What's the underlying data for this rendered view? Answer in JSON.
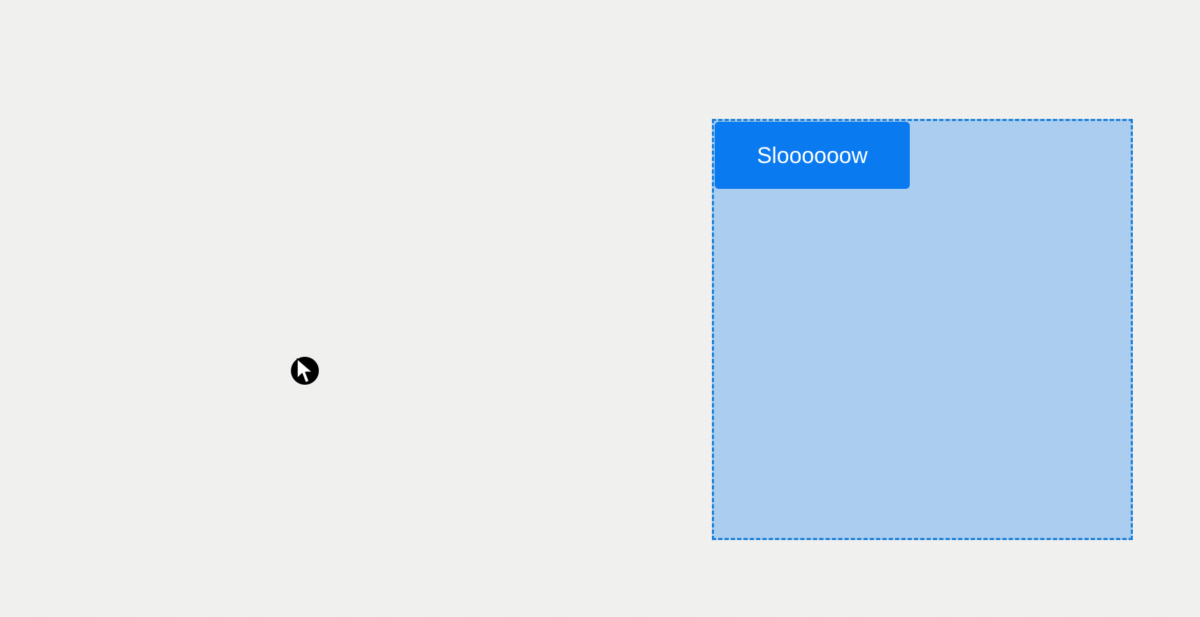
{
  "drop_zone": {
    "button_label": "Sloooooow",
    "colors": {
      "fill": "#abcdef",
      "border": "#1a7fd8",
      "button": "#0a7af0"
    }
  },
  "cursor": {
    "icon": "arrow-pointer-icon"
  }
}
